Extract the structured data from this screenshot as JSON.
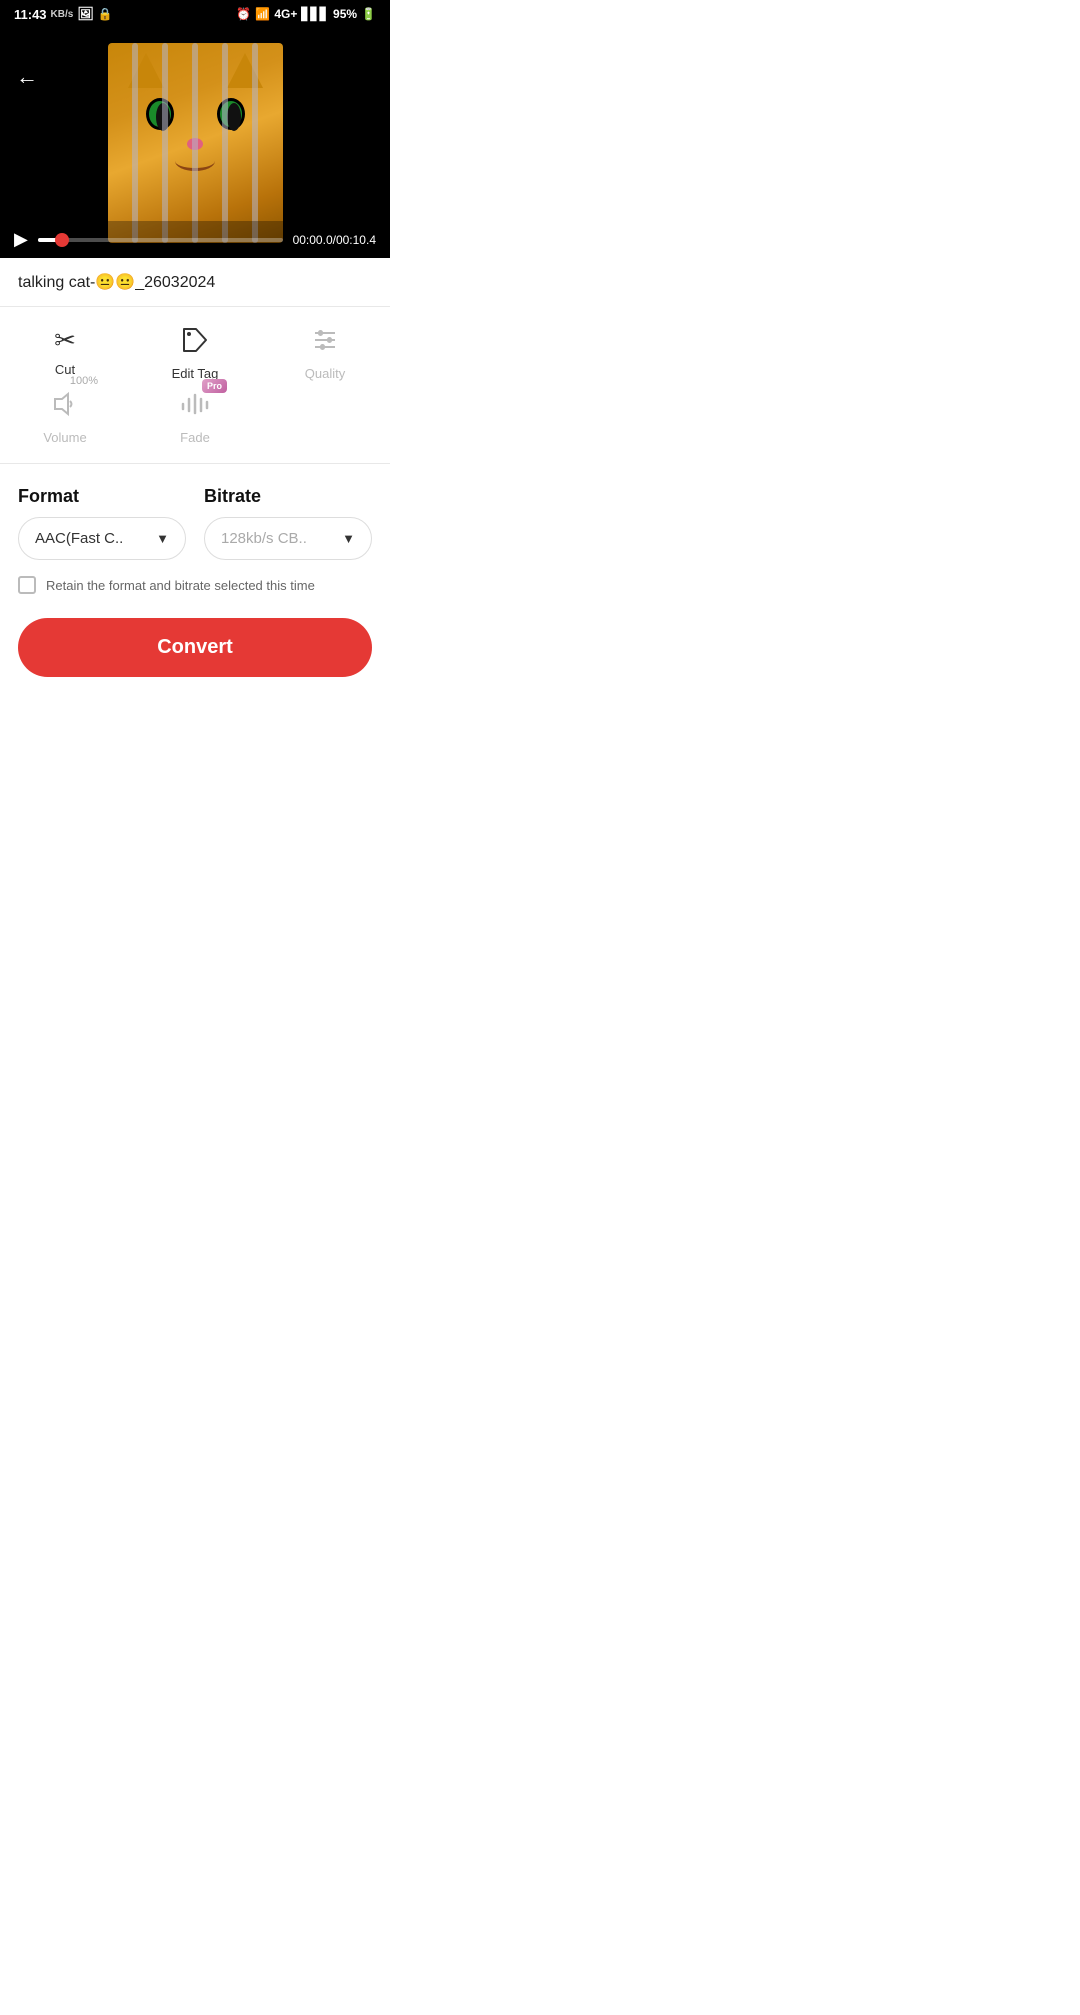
{
  "statusBar": {
    "time": "11:43",
    "networkSpeed": "KB/s",
    "battery": "95%",
    "signal": "4G+"
  },
  "videoPlayer": {
    "currentTime": "00:00.0",
    "totalTime": "00:10.4",
    "timeLabel": "00:00.0/00:10.4",
    "progressPercent": 8
  },
  "fileName": "talking cat-😐😐_26032024",
  "tools": {
    "cut": {
      "label": "Cut",
      "enabled": true
    },
    "editTag": {
      "label": "Edit Tag",
      "enabled": true
    },
    "quality": {
      "label": "Quality",
      "enabled": false
    },
    "volume": {
      "label": "Volume",
      "enabled": false,
      "percent": "100%"
    },
    "fade": {
      "label": "Fade",
      "enabled": false,
      "pro": true
    }
  },
  "format": {
    "label": "Format",
    "value": "AAC(Fast C..",
    "placeholder": "AAC(Fast C.."
  },
  "bitrate": {
    "label": "Bitrate",
    "value": "128kb/s CB..",
    "placeholder": "128kb/s CB.."
  },
  "retain": {
    "label": "Retain the format and bitrate selected this time",
    "checked": false
  },
  "convertButton": {
    "label": "Convert"
  }
}
